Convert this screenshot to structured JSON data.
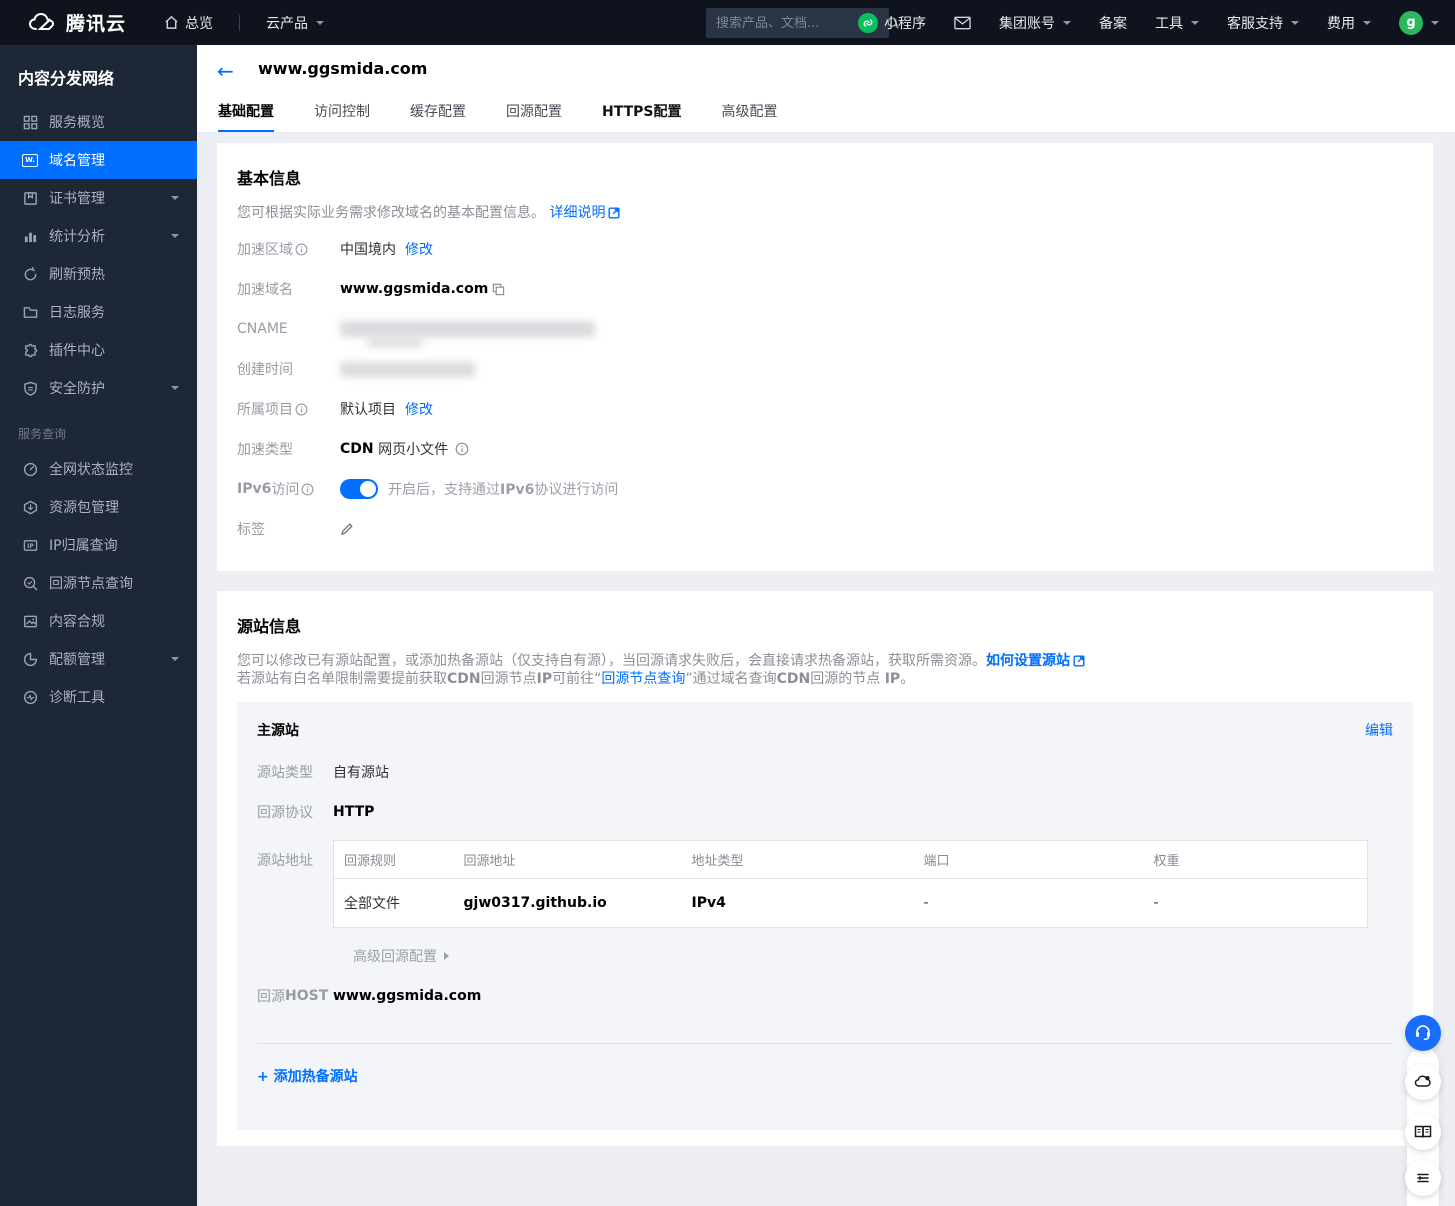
{
  "colors": {
    "accent": "#006eff",
    "topbar_bg": "#0e131d",
    "sidebar_bg": "#1e2736",
    "wechat_green": "#07c160",
    "avatar_green": "#2bb75c",
    "page_bg": "#edeff4"
  },
  "topbar": {
    "brand": "腾讯云",
    "overview": "总览",
    "products": "云产品",
    "search_placeholder": "搜索产品、文档...",
    "mini_program": "小程序",
    "group_account": "集团账号",
    "beian": "备案",
    "tools": "工具",
    "support": "客服支持",
    "billing": "费用",
    "avatar_letter": "g"
  },
  "sidebar": {
    "title": "内容分发网络",
    "items": [
      {
        "label": "服务概览"
      },
      {
        "label": "域名管理"
      },
      {
        "label": "证书管理"
      },
      {
        "label": "统计分析"
      },
      {
        "label": "刷新预热"
      },
      {
        "label": "日志服务"
      },
      {
        "label": "插件中心"
      },
      {
        "label": "安全防护"
      }
    ],
    "section_title": "服务查询",
    "section_items": [
      {
        "label": "全网状态监控"
      },
      {
        "label": "资源包管理"
      },
      {
        "label": "IP归属查询"
      },
      {
        "label": "回源节点查询"
      },
      {
        "label": "内容合规"
      },
      {
        "label": "配额管理"
      },
      {
        "label": "诊断工具"
      }
    ]
  },
  "header": {
    "title": "www.ggsmida.com",
    "tabs": [
      {
        "label": "基础配置"
      },
      {
        "label": "访问控制"
      },
      {
        "label": "缓存配置"
      },
      {
        "label": "回源配置"
      },
      {
        "label": "HTTPS配置"
      },
      {
        "label": "高级配置"
      }
    ]
  },
  "basic_info": {
    "title": "基本信息",
    "desc": "您可根据实际业务需求修改域名的基本配置信息。",
    "desc_link": "详细说明",
    "region_label": "加速区域",
    "region_value": "中国境内",
    "modify": "修改",
    "domain_label": "加速域名",
    "domain_value": "www.ggsmida.com",
    "cname_label": "CNAME",
    "created_label": "创建时间",
    "project_label": "所属项目",
    "project_value": "默认项目",
    "type_label": "加速类型",
    "type_bold": "CDN",
    "type_value": "网页小文件",
    "ipv6_label_bold": "IPv6",
    "ipv6_label_rest": "访问",
    "ipv6_pre": "开启后，支持通过",
    "ipv6_bold": "IPv6",
    "ipv6_post": "协议进行访问",
    "tag_label": "标签"
  },
  "origin_info": {
    "title": "源站信息",
    "desc1": "您可以修改已有源站配置，或添加热备源站（仅支持自有源），当回源请求失败后，会直接请求热备源站，获取所需资源。",
    "desc1_link": "如何设置源站",
    "desc2_seg1": "若源站有白名单限制需要提前获取",
    "desc2_b1": "CDN",
    "desc2_seg2": "回源节点",
    "desc2_b2": "IP",
    "desc2_seg3": "可前往“",
    "desc2_link": "回源节点查询",
    "desc2_seg4": "”通过域名查询",
    "desc2_b3": "CDN",
    "desc2_seg5": "回源的节点 ",
    "desc2_b4": "IP",
    "desc2_seg6": "。",
    "main_origin": {
      "title": "主源站",
      "edit": "编辑",
      "type_label": "源站类型",
      "type_value": "自有源站",
      "protocol_label": "回源协议",
      "protocol_value": "HTTP",
      "address_label": "源站地址",
      "table": {
        "headers": [
          "回源规则",
          "回源地址",
          "地址类型",
          "端口",
          "权重"
        ],
        "row": [
          "全部文件",
          "gjw0317.github.io",
          "IPv4",
          "-",
          "-"
        ]
      },
      "advanced": "高级回源配置",
      "host_label_cn": "回源",
      "host_label_en": "HOST",
      "host_value": "www.ggsmida.com",
      "add_backup": "+ 添加热备源站"
    }
  }
}
